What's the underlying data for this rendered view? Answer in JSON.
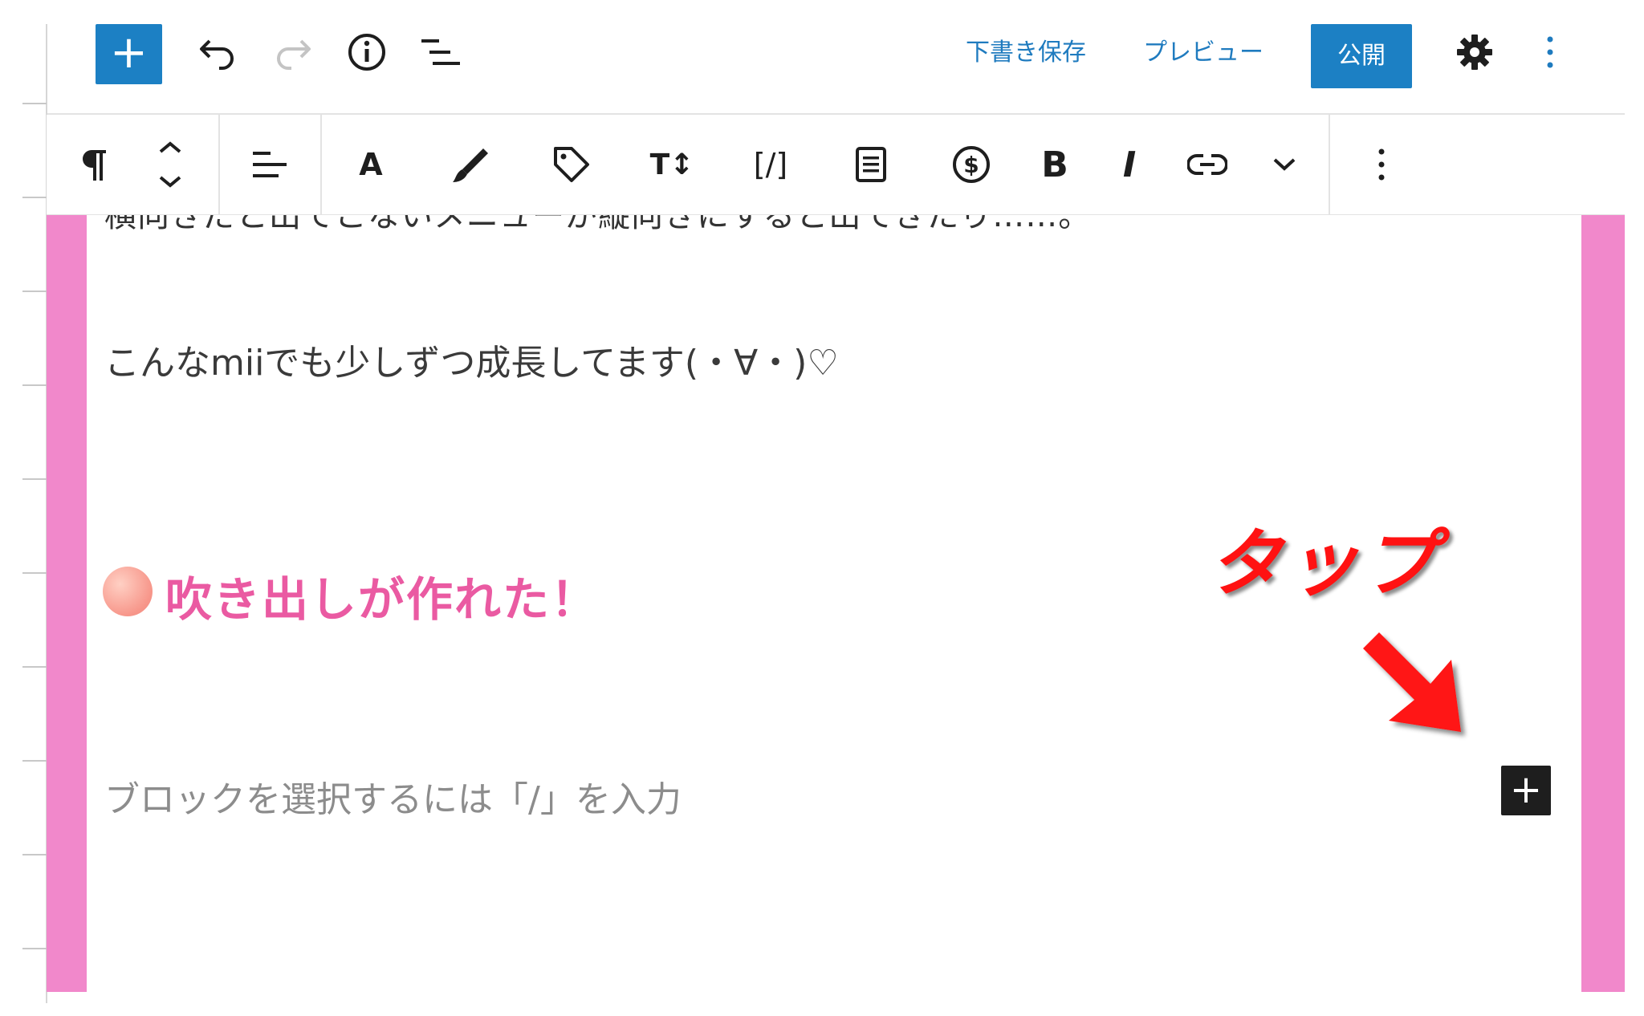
{
  "topbar": {
    "add_block": "+",
    "save_draft": "下書き保存",
    "preview": "プレビュー",
    "publish": "公開",
    "icons": [
      "undo-icon",
      "redo-icon",
      "info-icon",
      "list-view-icon",
      "gear-icon",
      "more-vertical-icon"
    ]
  },
  "block_toolbar": {
    "text_tool": "A",
    "bold": "B",
    "italic": "I",
    "font_size": "T↕",
    "shortcode": "[/]",
    "icons": [
      "paragraph-icon",
      "move-up-down-icon",
      "align-left-icon",
      "text-color-icon",
      "highlighter-icon",
      "tag-icon",
      "font-size-icon",
      "shortcode-icon",
      "document-icon",
      "dollar-icon",
      "bold-icon",
      "italic-icon",
      "link-icon",
      "chevron-down-icon",
      "more-vertical-icon"
    ]
  },
  "editor": {
    "partial_line": "横向きだと出てこないメニューが縦向きにすると出てきたり……。",
    "paragraph": "こんなmiiでも少しずつ成長してます(・∀・)♡",
    "heading": "吹き出しが作れた！",
    "placeholder": "ブロックを選択するには「/」を入力",
    "inline_add": "+"
  },
  "annotation": {
    "label": "タップ"
  },
  "colors": {
    "accent": "#1c80c4",
    "sidebar_pink": "#f188cb",
    "heading_pink": "#ea5aa2",
    "annotation_red": "#ff1212"
  }
}
